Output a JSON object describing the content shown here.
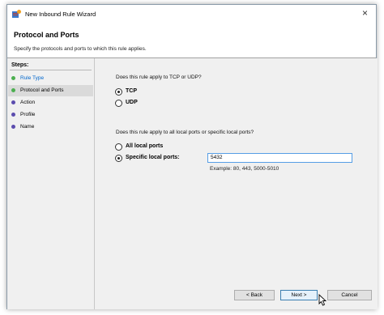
{
  "window": {
    "title": "New Inbound Rule Wizard",
    "close_glyph": "×"
  },
  "header": {
    "title": "Protocol and Ports",
    "subtitle": "Specify the protocols and ports to which this rule applies."
  },
  "steps": {
    "heading": "Steps:",
    "items": [
      {
        "label": "Rule Type",
        "color": "#0066cc",
        "dot": "#4caf50",
        "active": false
      },
      {
        "label": "Protocol and Ports",
        "color": "#000000",
        "dot": "#4caf50",
        "active": true
      },
      {
        "label": "Action",
        "color": "#000000",
        "dot": "#5b4cae",
        "active": false
      },
      {
        "label": "Profile",
        "color": "#000000",
        "dot": "#5b4cae",
        "active": false
      },
      {
        "label": "Name",
        "color": "#000000",
        "dot": "#5b4cae",
        "active": false
      }
    ]
  },
  "protocol": {
    "question": "Does this rule apply to TCP or UDP?",
    "options": [
      {
        "label": "TCP",
        "selected": true
      },
      {
        "label": "UDP",
        "selected": false
      }
    ]
  },
  "ports": {
    "question": "Does this rule apply to all local ports or specific local ports?",
    "options": [
      {
        "label": "All local ports",
        "selected": false
      },
      {
        "label": "Specific local ports:",
        "selected": true
      }
    ],
    "value": "5432",
    "example": "Example: 80, 443, 5000-5010"
  },
  "buttons": {
    "back": "< Back",
    "next": "Next >",
    "cancel": "Cancel"
  },
  "colors": {
    "accent": "#569de5",
    "link": "#0066cc"
  }
}
